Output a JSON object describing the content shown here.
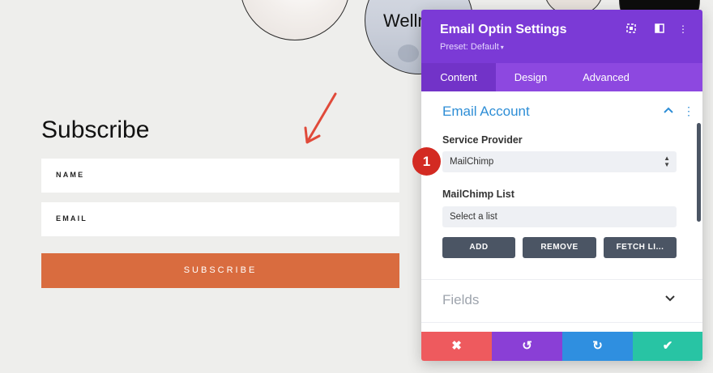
{
  "background_text": {
    "circle_word": "Wellr"
  },
  "form": {
    "title": "Subscribe",
    "name_label": "NAME",
    "email_label": "EMAIL",
    "submit_label": "SUBSCRIBE",
    "submit_color": "#d96c3f"
  },
  "panel": {
    "title": "Email Optin Settings",
    "preset": "Preset: Default",
    "header_color": "#7b3ad6",
    "header_icons": [
      "target-icon",
      "columns-icon",
      "kebab-icon"
    ],
    "tabs": [
      {
        "label": "Content",
        "active": true
      },
      {
        "label": "Design",
        "active": false
      },
      {
        "label": "Advanced",
        "active": false
      }
    ],
    "section": {
      "title": "Email Account",
      "service_provider_label": "Service Provider",
      "service_provider_value": "MailChimp",
      "list_label": "MailChimp List",
      "list_value": "Select a list",
      "buttons": [
        "ADD",
        "REMOVE",
        "FETCH LI..."
      ]
    },
    "fields_section_title": "Fields",
    "footer_buttons": [
      {
        "name": "cancel",
        "symbol": "✖",
        "color": "#ee5a5e"
      },
      {
        "name": "undo",
        "symbol": "↺",
        "color": "#8a3fd6"
      },
      {
        "name": "redo",
        "symbol": "↻",
        "color": "#2f8fe0"
      },
      {
        "name": "save",
        "symbol": "✔",
        "color": "#28c4a4"
      }
    ]
  },
  "annotation": {
    "badge_number": "1",
    "badge_color": "#d32a22"
  }
}
